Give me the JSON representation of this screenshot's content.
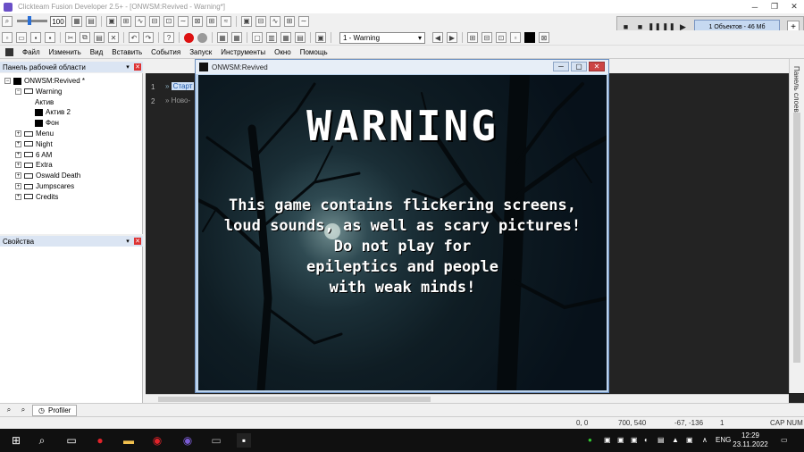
{
  "window": {
    "title": "Clickteam Fusion Developer 2.5+ - [ONWSM:Revived - Warning*]",
    "controls": [
      "─",
      "❐",
      "✕"
    ]
  },
  "toolbar": {
    "zoom_value": "100",
    "frame_select": "1 - Warning"
  },
  "profiler": {
    "info": "1 Объектов - 46 Мб",
    "add": "+"
  },
  "menubar": {
    "items": [
      "Файл",
      "Изменить",
      "Вид",
      "Вставить",
      "События",
      "Запуск",
      "Инструменты",
      "Окно",
      "Помощь"
    ]
  },
  "workspace_panel": {
    "title": "Панель рабочей области",
    "tree": [
      {
        "label": "ONWSM:Revived *",
        "level": 0,
        "icon": "black",
        "expander": "−"
      },
      {
        "label": "Warning",
        "level": 1,
        "icon": "frame",
        "expander": "−"
      },
      {
        "label": "Актив",
        "level": 2,
        "icon": "none",
        "expander": ""
      },
      {
        "label": "Актив 2",
        "level": 2,
        "icon": "black",
        "expander": ""
      },
      {
        "label": "Фон",
        "level": 2,
        "icon": "black",
        "expander": ""
      },
      {
        "label": "Menu",
        "level": 1,
        "icon": "frame",
        "expander": "+"
      },
      {
        "label": "Night",
        "level": 1,
        "icon": "frame",
        "expander": "+"
      },
      {
        "label": "6 AM",
        "level": 1,
        "icon": "frame",
        "expander": "+"
      },
      {
        "label": "Extra",
        "level": 1,
        "icon": "frame",
        "expander": "+"
      },
      {
        "label": "Oswald Death",
        "level": 1,
        "icon": "frame",
        "expander": "+"
      },
      {
        "label": "Jumpscares",
        "level": 1,
        "icon": "frame",
        "expander": "+"
      },
      {
        "label": "Credits",
        "level": 1,
        "icon": "frame",
        "expander": "+"
      }
    ]
  },
  "props_panel": {
    "title": "Свойства"
  },
  "editor": {
    "lines": [
      {
        "num": "1",
        "text": "Старт"
      },
      {
        "num": "2",
        "text": "Ново-"
      }
    ]
  },
  "right_panel": {
    "label": "Панель слоев"
  },
  "game_window": {
    "title": "ONWSM:Revived",
    "heading": "WARNING",
    "message_lines": [
      "This game contains flickering screens,",
      "loud sounds, as well as scary pictures!",
      "Do not play for",
      "epileptics and people",
      "with weak minds!"
    ]
  },
  "bottom_tabs": {
    "profiler_tab": "Profiler"
  },
  "statusbar": {
    "pos": "0, 0",
    "size": "700, 540",
    "coords": "-67, -136",
    "count": "1",
    "caps": "CAP NUM"
  },
  "taskbar": {
    "lang": "ENG",
    "time": "12:29",
    "date": "23.11.2022"
  }
}
